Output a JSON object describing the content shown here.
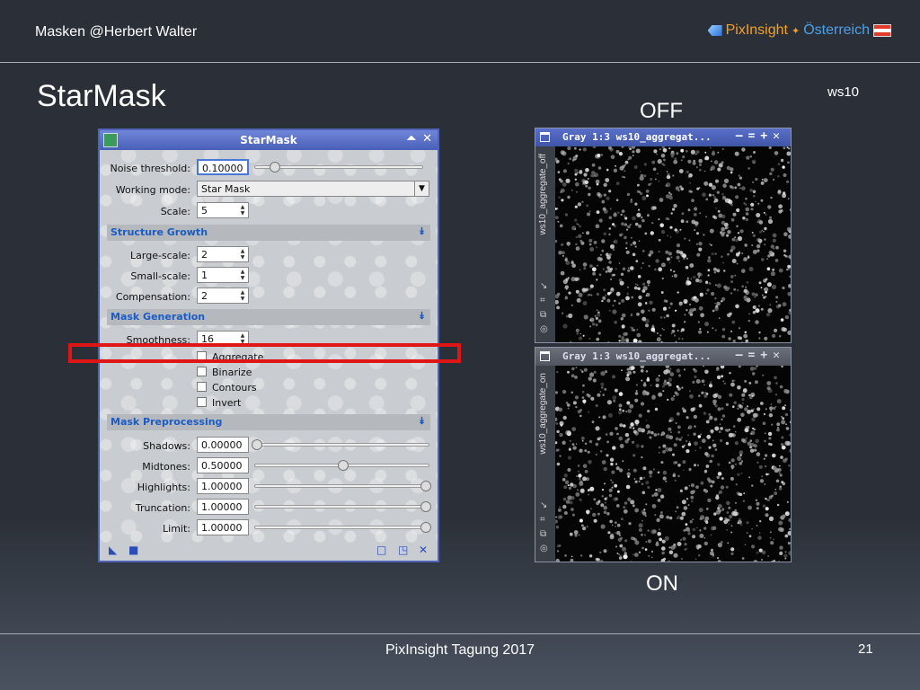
{
  "header": {
    "title": "Masken  @Herbert Walter",
    "brand_a": "PixInsight",
    "brand_b": "Österreich"
  },
  "slide": {
    "title": "StarMask",
    "tag": "ws10",
    "label_off": "OFF",
    "label_on": "ON"
  },
  "footer": {
    "text": "PixInsight Tagung 2017",
    "page": "21"
  },
  "dialog": {
    "title": "StarMask",
    "noise_threshold": {
      "label": "Noise threshold:",
      "value": "0.10000"
    },
    "working_mode": {
      "label": "Working mode:",
      "value": "Star Mask"
    },
    "scale": {
      "label": "Scale:",
      "value": "5"
    },
    "sections": {
      "structure": "Structure Growth",
      "mask_gen": "Mask Generation",
      "preproc": "Mask Preprocessing"
    },
    "large_scale": {
      "label": "Large-scale:",
      "value": "2"
    },
    "small_scale": {
      "label": "Small-scale:",
      "value": "1"
    },
    "compensation": {
      "label": "Compensation:",
      "value": "2"
    },
    "smoothness": {
      "label": "Smoothness:",
      "value": "16"
    },
    "checkboxes": {
      "aggregate": "Aggregate",
      "binarize": "Binarize",
      "contours": "Contours",
      "invert": "Invert"
    },
    "shadows": {
      "label": "Shadows:",
      "value": "0.00000",
      "level": 0.0
    },
    "midtones": {
      "label": "Midtones:",
      "value": "0.50000",
      "level": 0.5
    },
    "highlights": {
      "label": "Highlights:",
      "value": "1.00000",
      "level": 1.0
    },
    "truncation": {
      "label": "Truncation:",
      "value": "1.00000",
      "level": 1.0
    },
    "limit": {
      "label": "Limit:",
      "value": "1.00000",
      "level": 1.0
    }
  },
  "win_off": {
    "title": "Gray 1:3 ws10_aggregat...",
    "side": "ws10_aggregate_off"
  },
  "win_on": {
    "title": "Gray 1:3 ws10_aggregat...",
    "side": "ws10_aggregate_on"
  }
}
